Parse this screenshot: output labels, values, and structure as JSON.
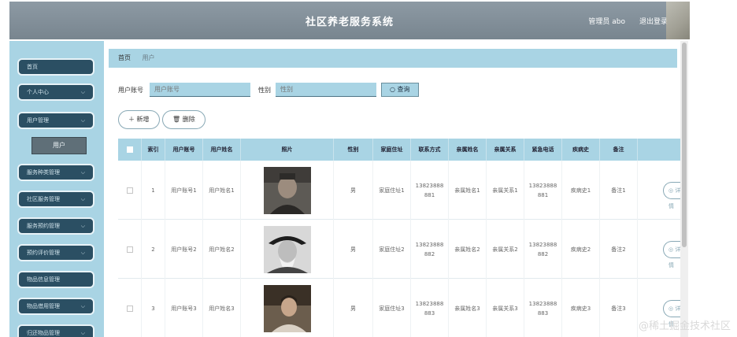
{
  "header": {
    "title": "社区养老服务系统",
    "admin_label": "管理员 abo",
    "logout_label": "退出登录"
  },
  "sidebar": {
    "items": [
      {
        "label": "首页",
        "has_chevron": false
      },
      {
        "label": "个人中心",
        "has_chevron": true
      },
      {
        "label": "用户管理",
        "has_chevron": true
      },
      {
        "label": "服务种类管理",
        "has_chevron": true
      },
      {
        "label": "社区服务管理",
        "has_chevron": true
      },
      {
        "label": "服务预约管理",
        "has_chevron": true
      },
      {
        "label": "预约评价管理",
        "has_chevron": true
      },
      {
        "label": "物品信息管理",
        "has_chevron": false
      },
      {
        "label": "物品借用管理",
        "has_chevron": true
      },
      {
        "label": "归还物品管理",
        "has_chevron": true
      }
    ],
    "active_submenu": "用户"
  },
  "breadcrumb": {
    "home": "首页",
    "current": "用户"
  },
  "search": {
    "account_label": "用户账号",
    "account_placeholder": "用户账号",
    "gender_label": "性别",
    "gender_placeholder": "性别",
    "query_label": "查询"
  },
  "actions": {
    "add_label": "新增",
    "delete_label": "删除"
  },
  "table": {
    "columns": [
      "索引",
      "用户账号",
      "用户姓名",
      "照片",
      "性别",
      "家庭住址",
      "联系方式",
      "亲属姓名",
      "亲属关系",
      "紧急电话",
      "疾病史",
      "备注"
    ],
    "rows": [
      {
        "index": "1",
        "account": "用户账号1",
        "name": "用户姓名1",
        "gender": "男",
        "address": "家庭住址1",
        "phone": "13823888881",
        "relative_name": "亲属姓名1",
        "relation": "亲属关系1",
        "emergency": "13823888881",
        "disease": "疾病史1",
        "note": "备注1"
      },
      {
        "index": "2",
        "account": "用户账号2",
        "name": "用户姓名2",
        "gender": "男",
        "address": "家庭住址2",
        "phone": "13823888882",
        "relative_name": "亲属姓名2",
        "relation": "亲属关系2",
        "emergency": "13823888882",
        "disease": "疾病史2",
        "note": "备注2"
      },
      {
        "index": "3",
        "account": "用户账号3",
        "name": "用户姓名3",
        "gender": "男",
        "address": "家庭住址3",
        "phone": "13823888883",
        "relative_name": "亲属姓名3",
        "relation": "亲属关系3",
        "emergency": "13823888883",
        "disease": "疾病史3",
        "note": "备注3"
      }
    ],
    "row_action_label": "详情"
  },
  "watermark": "@稀土掘金技术社区",
  "colors": {
    "header": "#78858f",
    "sidebar": "#a9d4e4",
    "menu_item": "#2b4f63",
    "accent": "#a9d4e4"
  }
}
